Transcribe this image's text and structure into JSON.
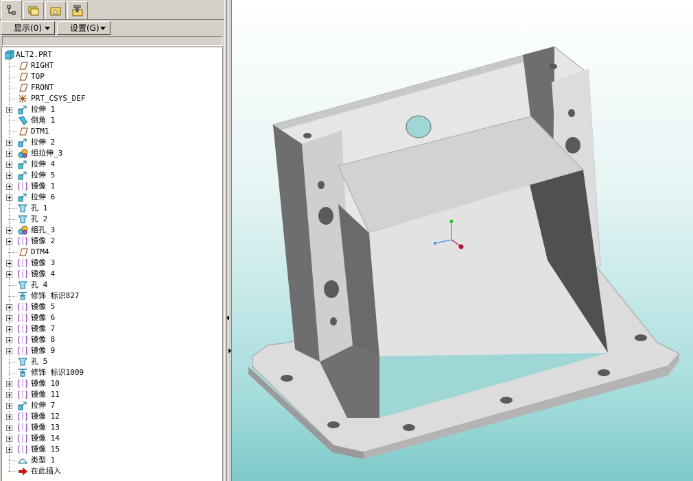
{
  "left_panel": {
    "tabs": [
      {
        "name": "model-tree-tab",
        "icon": "model-tree-icon",
        "active": true
      },
      {
        "name": "folder-browser-tab",
        "icon": "folder-icon",
        "active": false
      },
      {
        "name": "favorites-tab",
        "icon": "favorites-icon",
        "active": false
      },
      {
        "name": "connections-tab",
        "icon": "tools-icon",
        "active": false
      }
    ],
    "menu": {
      "show_label": "显示(0)",
      "settings_label": "设置(G)"
    }
  },
  "tree": {
    "root": "ALT2.PRT",
    "items": [
      {
        "label": "RIGHT",
        "icon": "datum-plane-icon",
        "expandable": false
      },
      {
        "label": "TOP",
        "icon": "datum-plane-icon",
        "expandable": false
      },
      {
        "label": "FRONT",
        "icon": "datum-plane-icon",
        "expandable": false
      },
      {
        "label": "PRT_CSYS_DEF",
        "icon": "csys-icon",
        "expandable": false
      },
      {
        "label": "拉伸 1",
        "icon": "extrude-icon",
        "expandable": true
      },
      {
        "label": "倒角 1",
        "icon": "chamfer-icon",
        "expandable": false
      },
      {
        "label": "DTM1",
        "icon": "datum-plane-icon",
        "expandable": false
      },
      {
        "label": "拉伸 2",
        "icon": "extrude-icon",
        "expandable": true
      },
      {
        "label": "组拉伸_3",
        "icon": "group-icon",
        "expandable": true
      },
      {
        "label": "拉伸 4",
        "icon": "extrude-icon",
        "expandable": true
      },
      {
        "label": "拉伸 5",
        "icon": "extrude-icon",
        "expandable": true
      },
      {
        "label": "镜像 1",
        "icon": "mirror-icon",
        "expandable": true
      },
      {
        "label": "拉伸 6",
        "icon": "extrude-icon",
        "expandable": true
      },
      {
        "label": "孔 1",
        "icon": "hole-icon",
        "expandable": false
      },
      {
        "label": "孔 2",
        "icon": "hole-icon",
        "expandable": false
      },
      {
        "label": "组孔_3",
        "icon": "group-icon",
        "expandable": true
      },
      {
        "label": "镜像 2",
        "icon": "mirror-icon",
        "expandable": true
      },
      {
        "label": "DTM4",
        "icon": "datum-plane-icon",
        "expandable": false
      },
      {
        "label": "镜像 3",
        "icon": "mirror-icon",
        "expandable": true
      },
      {
        "label": "镜像 4",
        "icon": "mirror-icon",
        "expandable": true
      },
      {
        "label": "孔 4",
        "icon": "hole-icon",
        "expandable": false
      },
      {
        "label": "修饰 标识827",
        "icon": "cosmetic-icon",
        "expandable": false
      },
      {
        "label": "镜像 5",
        "icon": "mirror-icon",
        "expandable": true
      },
      {
        "label": "镜像 6",
        "icon": "mirror-icon",
        "expandable": true
      },
      {
        "label": "镜像 7",
        "icon": "mirror-icon",
        "expandable": true
      },
      {
        "label": "镜像 8",
        "icon": "mirror-icon",
        "expandable": true
      },
      {
        "label": "镜像 9",
        "icon": "mirror-icon",
        "expandable": true
      },
      {
        "label": "孔 5",
        "icon": "hole-icon",
        "expandable": false
      },
      {
        "label": "修饰 标识1009",
        "icon": "cosmetic-icon",
        "expandable": false
      },
      {
        "label": "镜像 10",
        "icon": "mirror-icon",
        "expandable": true
      },
      {
        "label": "镜像 11",
        "icon": "mirror-icon",
        "expandable": true
      },
      {
        "label": "拉伸 7",
        "icon": "extrude-icon",
        "expandable": true
      },
      {
        "label": "镜像 12",
        "icon": "mirror-icon",
        "expandable": true
      },
      {
        "label": "镜像 13",
        "icon": "mirror-icon",
        "expandable": true
      },
      {
        "label": "镜像 14",
        "icon": "mirror-icon",
        "expandable": true
      },
      {
        "label": "镜像 15",
        "icon": "mirror-icon",
        "expandable": true
      },
      {
        "label": "类型 1",
        "icon": "pattern-icon",
        "expandable": false
      },
      {
        "label": "在此插入",
        "icon": "insert-here-icon",
        "expandable": false
      }
    ]
  },
  "colors": {
    "panel_bg": "#d4d0c8",
    "viewport_top": "#ffffff",
    "viewport_bottom": "#7fcaca",
    "model_light": "#dcdcdc",
    "model_mid": "#bcbcbc",
    "model_dark": "#6e6e6e",
    "axis_x": "#b0103a",
    "axis_y": "#19c819",
    "axis_z": "#3c8cf0"
  }
}
